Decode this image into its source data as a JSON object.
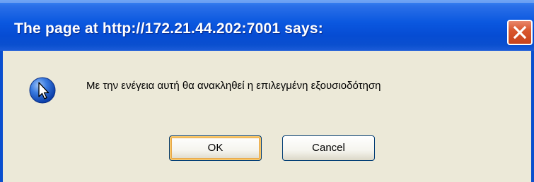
{
  "dialog": {
    "title": "The page at http://172.21.44.202:7001 says:",
    "message": "Με την ενέγεια αυτή θα ανακληθεί η επιλεγμένη εξουσιοδότηση",
    "icon": "info-cursor-icon",
    "buttons": {
      "ok_label": "OK",
      "cancel_label": "Cancel"
    },
    "close_icon": "close-icon"
  },
  "colors": {
    "titlebar": "#0a57df",
    "close_button": "#d9572f",
    "body": "#ece9d8",
    "title_text": "#ffffff"
  }
}
